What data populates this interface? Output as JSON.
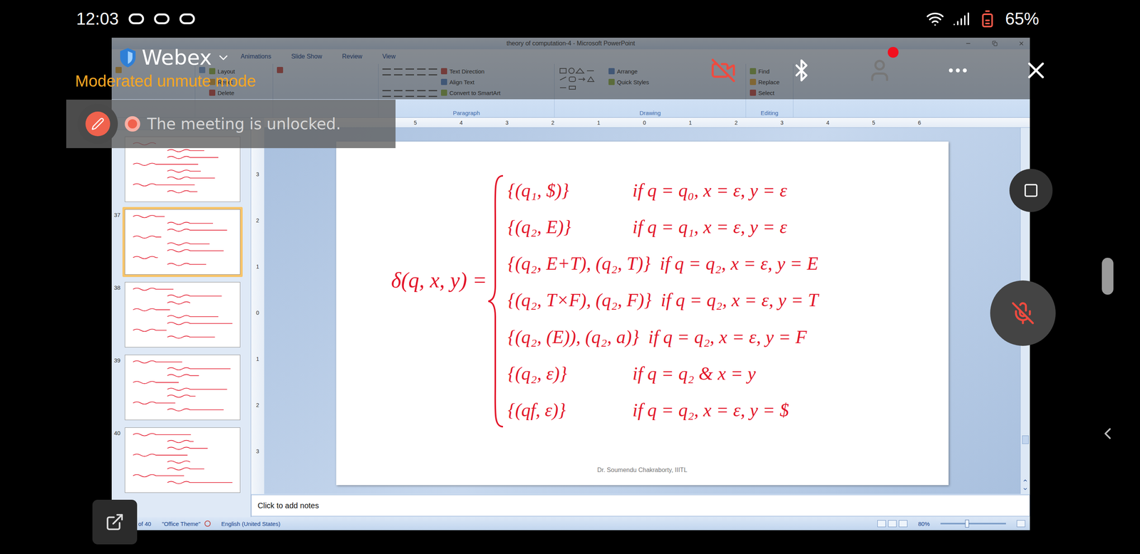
{
  "status_bar": {
    "time": "12:03",
    "battery": "65%"
  },
  "webex": {
    "app": "Webex",
    "mode": "Moderated unmute mode",
    "toast": "The meeting is unlocked.",
    "camera_off": true,
    "mic_muted": true,
    "has_alert": true
  },
  "window": {
    "title": "theory of computation-4 - Microsoft PowerPoint"
  },
  "ribbon": {
    "tabs": [
      {
        "label": "Animations",
        "selected": false
      },
      {
        "label": "Slide Show",
        "selected": false
      },
      {
        "label": "Review",
        "selected": false
      },
      {
        "label": "View",
        "selected": false
      }
    ],
    "groups": [
      {
        "buttons": []
      },
      {
        "buttons": [
          "Layout",
          "Reset",
          "Delete"
        ]
      },
      {
        "buttons": []
      },
      {
        "label": "Paragraph",
        "buttons": [
          "Text Direction",
          "Align Text",
          "Convert to SmartArt"
        ]
      },
      {
        "label": "Drawing",
        "buttons": [
          "Arrange",
          "Quick Styles"
        ]
      },
      {
        "label": "Editing",
        "buttons": [
          "Find",
          "Replace",
          "Select"
        ]
      }
    ]
  },
  "ruler": {
    "horizontal": [
      "5",
      "4",
      "3",
      "2",
      "1",
      "0",
      "1",
      "2",
      "3",
      "4",
      "5",
      "6"
    ],
    "vertical": [
      "3",
      "2",
      "1",
      "0",
      "1",
      "2",
      "3"
    ]
  },
  "slides_panel": {
    "slides": [
      {
        "number": "37",
        "selected": true
      },
      {
        "number": "38",
        "selected": false
      },
      {
        "number": "39",
        "selected": false
      },
      {
        "number": "40",
        "selected": false
      }
    ]
  },
  "slide": {
    "lhs": "δ(q, x, y) =",
    "cases": [
      {
        "value": "{(q₁, $)}",
        "condition": "if q = q₀, x = ε, y = ε"
      },
      {
        "value": "{(q₂, E)}",
        "condition": "if q = q₁, x = ε, y = ε"
      },
      {
        "value": "{(q₂, E+T), (q₂, T)}",
        "condition": "if q = q₂, x = ε, y = E"
      },
      {
        "value": "{(q₂, T×F), (q₂, F)}",
        "condition": "if q = q₂, x = ε, y = T"
      },
      {
        "value": "{(q₂, (E)), (q₂, a)}",
        "condition": "if q = q₂, x = ε, y = F"
      },
      {
        "value": "{(q₂, ε)}",
        "condition": "if q = q₂ & x = y"
      },
      {
        "value": "{(qf, ε)}",
        "condition": "if q = q₂, x = ε, y = $"
      }
    ],
    "footer": "Dr. Soumendu Chakraborty, IIITL"
  },
  "notes": {
    "placeholder": "Click to add notes"
  },
  "app_status": {
    "slide_count": "of 40",
    "theme": "\"Office Theme\"",
    "language": "English (United States)",
    "zoom": "80%",
    "zoom_level": 0.4
  }
}
